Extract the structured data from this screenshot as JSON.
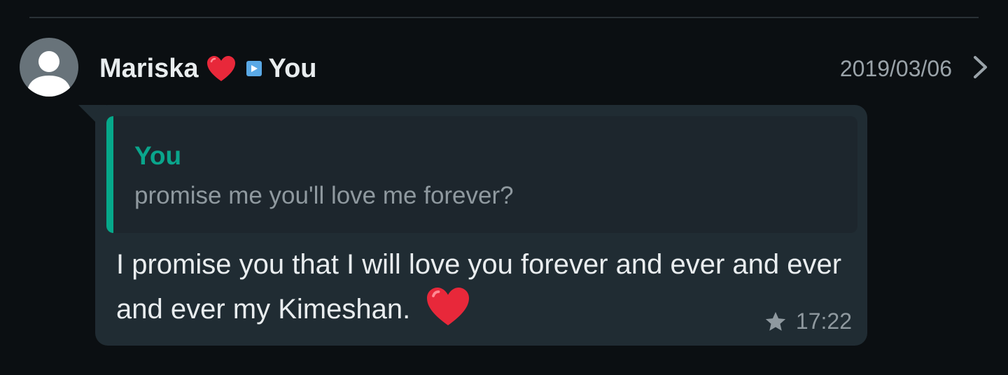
{
  "header": {
    "sender": "Mariska",
    "recipient": "You",
    "date": "2019/03/06"
  },
  "message": {
    "quote": {
      "sender": "You",
      "text": "promise me you'll love me forever?"
    },
    "text": "I promise you that I will love you forever and ever and ever and ever my Kimeshan.",
    "time": "17:22",
    "starred": true
  },
  "colors": {
    "background": "#0b0f12",
    "bubble": "#202c33",
    "quote_accent": "#06a88a",
    "heart": "#e8283a"
  },
  "icons": [
    "avatar-placeholder-icon",
    "heart-icon",
    "play-icon",
    "chevron-right-icon",
    "star-icon"
  ]
}
